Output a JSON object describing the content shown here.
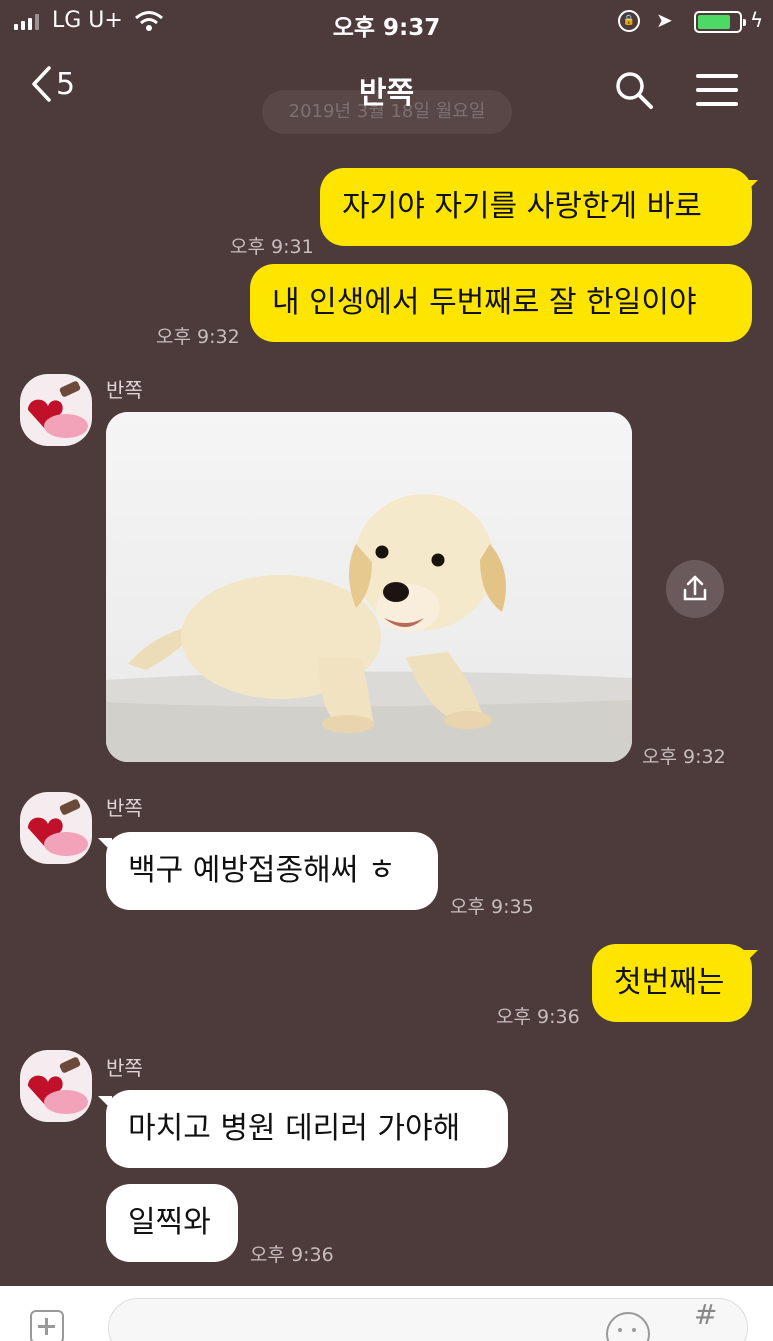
{
  "status_bar": {
    "carrier": "LG U+",
    "time": "오후 9:37",
    "battery_level": 0.8
  },
  "header": {
    "back_count": "5",
    "title": "반쪽",
    "date_divider": "2019년 3월 18일 월요일"
  },
  "messages": {
    "m1": {
      "text": "자기야 자기를 사랑한게 바로",
      "time": "오후 9:31"
    },
    "m2": {
      "text": "내 인생에서 두번째로 잘 한일이야",
      "time": "오후 9:32"
    },
    "m3": {
      "sender": "반쪽",
      "time": "오후 9:32",
      "content": "puppy photo"
    },
    "m4": {
      "sender": "반쪽",
      "text": "백구 예방접종해써 ㅎ",
      "time": "오후 9:35"
    },
    "m5": {
      "text": "첫번째는",
      "time": "오후 9:36"
    },
    "m6": {
      "sender": "반쪽",
      "text": "마치고 병원 데리러 가야해"
    },
    "m7": {
      "text": "일찍와",
      "time": "오후 9:36"
    }
  },
  "icons": {
    "back": "chevron-left-icon",
    "search": "search-icon",
    "menu": "hamburger-menu-icon",
    "share": "share-icon",
    "plus": "plus-icon",
    "emoji": "emoji-icon",
    "hash": "hash-icon"
  },
  "colors": {
    "background": "#4d3a3b",
    "my_bubble": "#fee500",
    "their_bubble": "#ffffff"
  },
  "input_bar": {
    "placeholder": "",
    "hash_label": "#"
  }
}
